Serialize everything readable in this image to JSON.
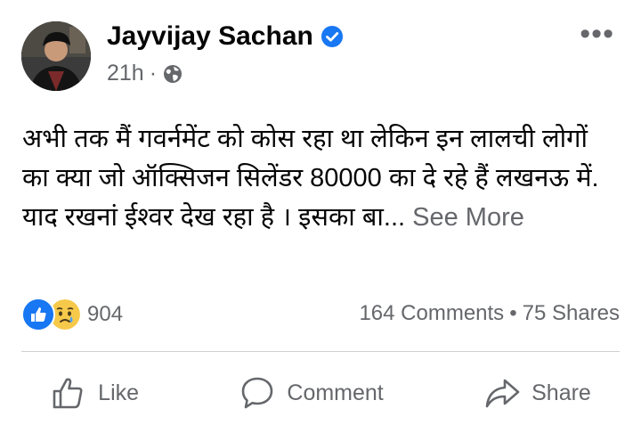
{
  "post": {
    "author": "Jayvijay Sachan",
    "timestamp": "21h",
    "separator": "·",
    "privacy_icon": "globe-icon",
    "menu_label": "•••",
    "text": "अभी तक मैं गवर्नमेंट को कोस रहा था लेकिन इन लालची लोगों का क्या जो ऑक्सिजन सिलेंडर 80000 का दे रहे हैं लखनऊ में. याद रखनां ईश्वर देख रहा है । इसका बा...",
    "see_more": "See More"
  },
  "engagement": {
    "reaction_icons": [
      "like-icon",
      "sad-icon"
    ],
    "reaction_count": "904",
    "comments": "164 Comments",
    "dot": "•",
    "shares": "75 Shares"
  },
  "actions": {
    "like": "Like",
    "comment": "Comment",
    "share": "Share"
  },
  "colors": {
    "text": "#050505",
    "secondary": "#65676b",
    "brand_blue": "#1877f2"
  }
}
